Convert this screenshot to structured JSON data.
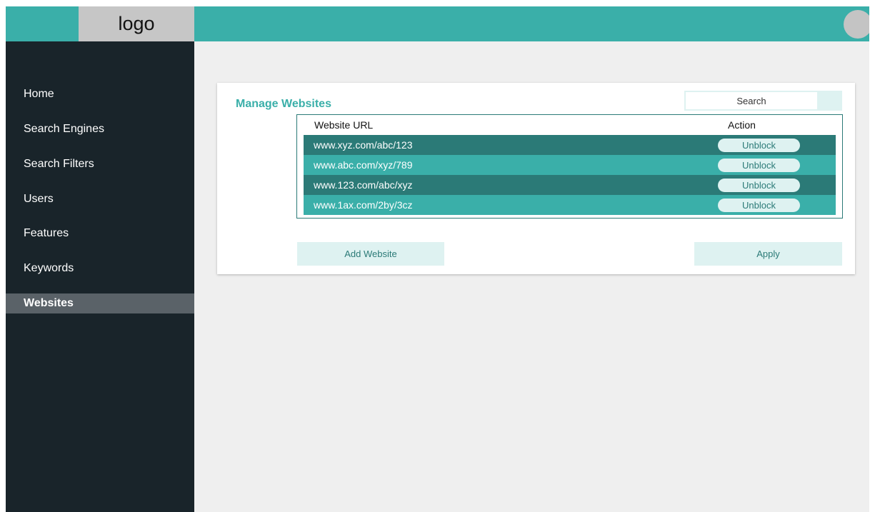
{
  "header": {
    "logo_text": "logo",
    "avatar_icon": "user-avatar-circle"
  },
  "sidebar": {
    "items": [
      {
        "label": "Home",
        "active": false
      },
      {
        "label": "Search Engines",
        "active": false
      },
      {
        "label": "Search Filters",
        "active": false
      },
      {
        "label": "Users",
        "active": false
      },
      {
        "label": "Features",
        "active": false
      },
      {
        "label": "Keywords",
        "active": false
      },
      {
        "label": "Websites",
        "active": true
      }
    ]
  },
  "main": {
    "title": "Manage Websites",
    "search": {
      "placeholder": "Search",
      "value": ""
    },
    "table": {
      "columns": [
        "Website URL",
        "Action"
      ],
      "rows": [
        {
          "url": "www.xyz.com/abc/123",
          "action": "Unblock"
        },
        {
          "url": "www.abc.com/xyz/789",
          "action": "Unblock"
        },
        {
          "url": "www.123.com/abc/xyz",
          "action": "Unblock"
        },
        {
          "url": "www.1ax.com/2by/3cz",
          "action": "Unblock"
        }
      ]
    },
    "add_button": "Add Website",
    "apply_button": "Apply"
  },
  "colors": {
    "accent": "#3aafa9",
    "accent_dark": "#2b7a77",
    "accent_light": "#def2f1",
    "sidebar_bg": "#19242a",
    "sidebar_active": "#5a6268",
    "page_bg": "#efefef"
  }
}
